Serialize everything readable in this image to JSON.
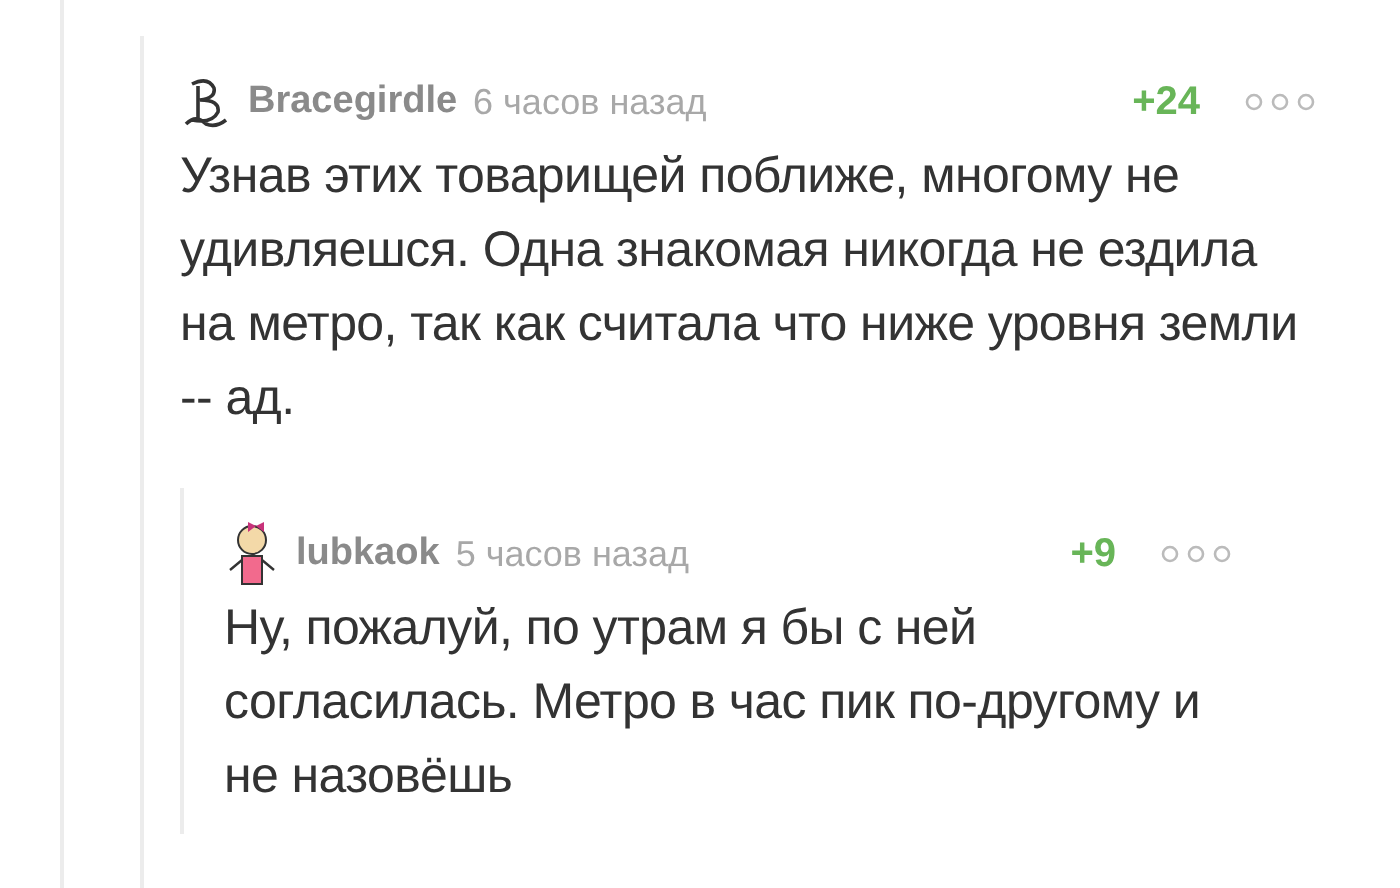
{
  "comments": [
    {
      "author": "Bracegirdle",
      "time": "6 часов назад",
      "rating": "+24",
      "avatar": {
        "kind": "monogram"
      },
      "text": "Узнав этих товарищей поближе, многому не удивляешся. Одна знакомая никогда не ездила на метро, так как считала что ниже уровня земли -- ад.",
      "children": [
        {
          "author": "lubkaok",
          "time": "5 часов назад",
          "rating": "+9",
          "avatar": {
            "kind": "figure"
          },
          "text": "Ну, пожалуй, по утрам я бы с ней согласилась. Метро в час пик по-другому и не назовёшь"
        }
      ]
    }
  ]
}
